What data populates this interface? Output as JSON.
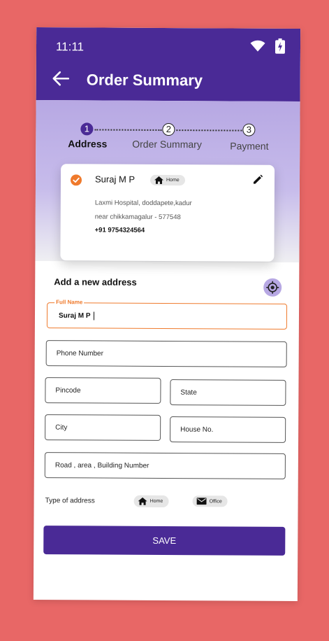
{
  "status_bar": {
    "time": "11:11"
  },
  "app_bar": {
    "title": "Order Summary"
  },
  "stepper": {
    "steps": [
      {
        "number": "1",
        "label": "Address",
        "active": true
      },
      {
        "number": "2",
        "label": "Order Summary",
        "active": false
      },
      {
        "number": "3",
        "label": "Payment",
        "active": false
      }
    ]
  },
  "selected_address": {
    "name": "Suraj M P",
    "tag": "Home",
    "line1": "Laxmi Hospital, doddapete,kadur",
    "line2": "near chikkamagalur - 577548",
    "phone": "+91 9754324564"
  },
  "form": {
    "title": "Add  a new address",
    "full_name": {
      "label": "Full Name",
      "value": "Suraj M P"
    },
    "phone": {
      "placeholder": "Phone Number"
    },
    "pincode": {
      "placeholder": "Pincode"
    },
    "state": {
      "placeholder": "State"
    },
    "city": {
      "placeholder": "City"
    },
    "house": {
      "placeholder": "House No."
    },
    "road": {
      "placeholder": "Road , area , Building Number"
    },
    "type_label": "Type of address",
    "type_options": [
      "Home",
      "Office"
    ],
    "save_label": "SAVE"
  },
  "colors": {
    "primary": "#4A2A96",
    "accent": "#EF7A2C",
    "background": "#E86766",
    "hero": "#B7A8E3"
  }
}
